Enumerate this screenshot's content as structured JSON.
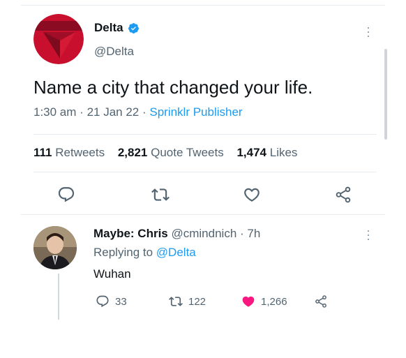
{
  "tweet": {
    "author_name": "Delta",
    "author_handle": "@Delta",
    "text": "Name a city that changed your life.",
    "time": "1:30 am",
    "date": "21 Jan 22",
    "source": "Sprinklr Publisher",
    "retweets_count": "111",
    "retweets_label": "Retweets",
    "quotes_count": "2,821",
    "quotes_label": "Quote Tweets",
    "likes_count": "1,474",
    "likes_label": "Likes"
  },
  "reply": {
    "author_name": "Maybe: Chris",
    "author_handle": "@cmindnich",
    "age": "7h",
    "replying_prefix": "Replying to",
    "replying_to": "@Delta",
    "text": "Wuhan",
    "reply_count": "33",
    "retweet_count": "122",
    "like_count": "1,266"
  },
  "colors": {
    "accent": "#1d9bf0",
    "like": "#f91880",
    "delta_red": "#c8102e",
    "muted": "#536471"
  },
  "icons": [
    "more-icon",
    "verified-icon",
    "reply-icon",
    "retweet-icon",
    "like-icon",
    "share-icon",
    "delta-logo"
  ]
}
